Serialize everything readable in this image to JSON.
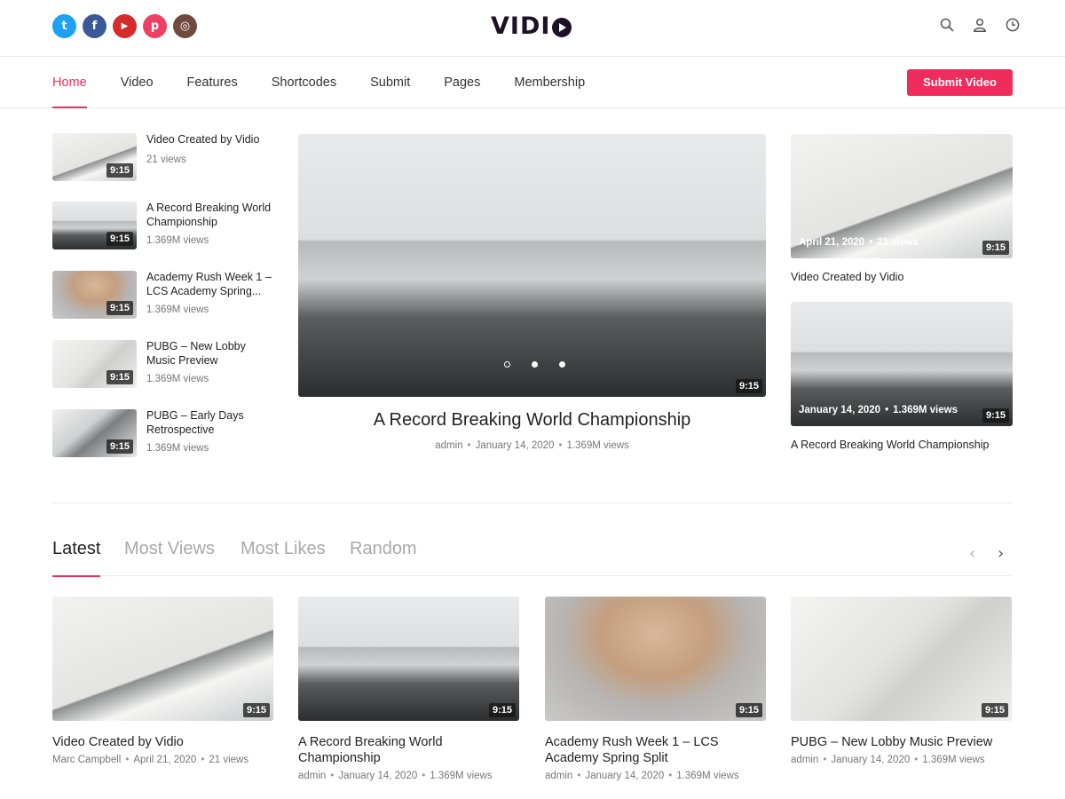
{
  "brand": {
    "logo_text": "VIDI",
    "accent": "#ef2c5b"
  },
  "social": [
    {
      "name": "twitter-icon",
      "glyph": "t",
      "color": "#1da1f2"
    },
    {
      "name": "facebook-icon",
      "glyph": "f",
      "color": "#3b5998"
    },
    {
      "name": "youtube-icon",
      "glyph": "▶",
      "color": "#d62b2b"
    },
    {
      "name": "pinterest-icon",
      "glyph": "p",
      "color": "#ef3f64"
    },
    {
      "name": "instagram-icon",
      "glyph": "◎",
      "color": "#6f4a3d"
    }
  ],
  "header_tools": [
    "search-icon",
    "user-icon",
    "clock-icon"
  ],
  "nav": {
    "items": [
      "Home",
      "Video",
      "Features",
      "Shortcodes",
      "Submit",
      "Pages",
      "Membership"
    ],
    "active": "Home",
    "submit_label": "Submit Video"
  },
  "side_list": [
    {
      "title": "Video Created by Vidio",
      "views": "21 views",
      "duration": "9:15"
    },
    {
      "title": "A Record Breaking World Championship",
      "views": "1.369M views",
      "duration": "9:15"
    },
    {
      "title": "Academy Rush Week 1 – LCS Academy Spring...",
      "views": "1.369M views",
      "duration": "9:15"
    },
    {
      "title": "PUBG – New Lobby Music Preview",
      "views": "1.369M views",
      "duration": "9:15"
    },
    {
      "title": "PUBG – Early Days Retrospective",
      "views": "1.369M views",
      "duration": "9:15"
    }
  ],
  "featured": {
    "title": "A Record Breaking World Championship",
    "author": "admin",
    "date": "January 14, 2020",
    "views": "1.369M views",
    "duration": "9:15"
  },
  "right_cards": [
    {
      "date": "April 21, 2020",
      "views": "21 views",
      "duration": "9:15",
      "title": "Video Created by Vidio"
    },
    {
      "date": "January 14, 2020",
      "views": "1.369M views",
      "duration": "9:15",
      "title": "A Record Breaking World Championship"
    }
  ],
  "tabs": {
    "items": [
      "Latest",
      "Most Views",
      "Most Likes",
      "Random"
    ],
    "active": "Latest",
    "prev": "‹",
    "next": "›"
  },
  "grid": [
    {
      "title": "Video Created by Vidio",
      "author": "Marc Campbell",
      "date": "April 21, 2020",
      "views": "21 views",
      "duration": "9:15"
    },
    {
      "title": "A Record Breaking World Championship",
      "author": "admin",
      "date": "January 14, 2020",
      "views": "1.369M views",
      "duration": "9:15"
    },
    {
      "title": "Academy Rush Week 1 – LCS Academy Spring Split",
      "author": "admin",
      "date": "January 14, 2020",
      "views": "1.369M views",
      "duration": "9:15"
    },
    {
      "title": "PUBG – New Lobby Music Preview",
      "author": "admin",
      "date": "January 14, 2020",
      "views": "1.369M views",
      "duration": "9:15"
    }
  ],
  "meta_separator": "•"
}
